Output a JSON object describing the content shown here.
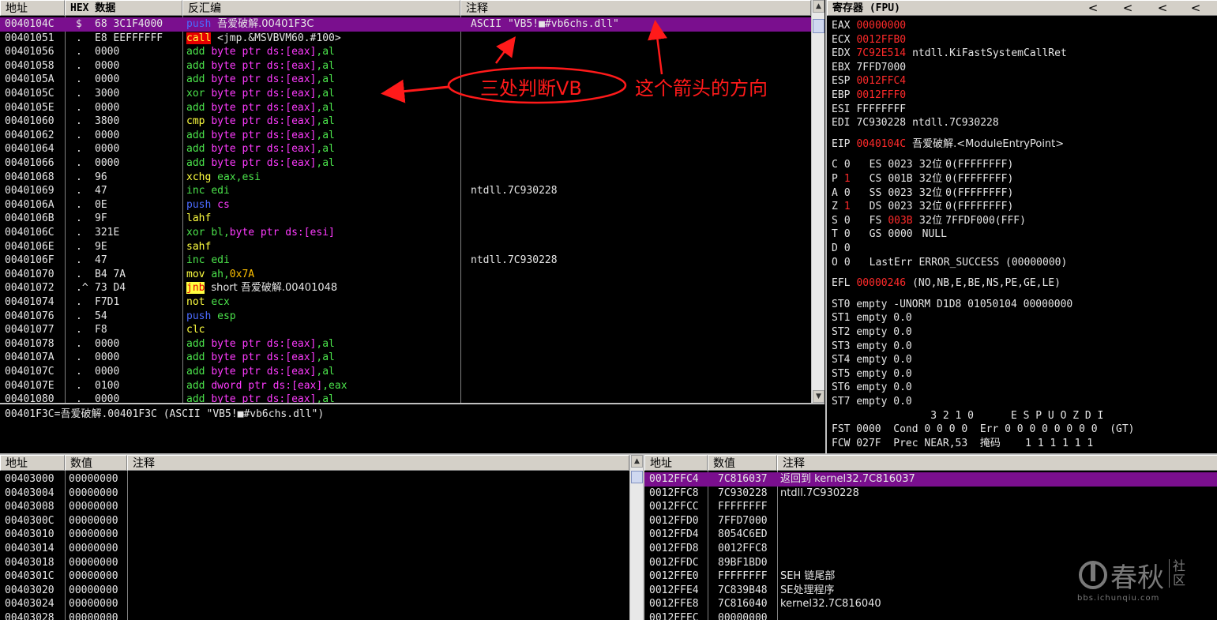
{
  "disasm": {
    "headers": {
      "address": "地址",
      "hex": "HEX 数据",
      "disasm": "反汇编",
      "comment": "注释"
    },
    "rows": [
      {
        "addr": "0040104C",
        "mark": "$",
        "hex": "68 3C1F4000",
        "op": "push",
        "args": [
          {
            "t": "吾爱破解.00401F3C",
            "c": "w"
          }
        ],
        "comment": "ASCII \"VB5!■#vb6chs.dll\"",
        "sel": true,
        "opc": "blue"
      },
      {
        "addr": "00401051",
        "mark": ".",
        "hex": "E8 EEFFFFFF",
        "op": "call",
        "args": [
          {
            "t": "<jmp.&MSVBVM60.#100>",
            "c": "w"
          }
        ],
        "comment": "",
        "opc": "hlred"
      },
      {
        "addr": "00401056",
        "mark": ".",
        "hex": "0000",
        "op": "add",
        "args": [
          {
            "t": "byte ptr ",
            "c": "mag"
          },
          {
            "t": "ds:[eax]",
            "c": "mag"
          },
          {
            "t": ",al",
            "c": "grn"
          }
        ],
        "comment": "",
        "opc": "grn"
      },
      {
        "addr": "00401058",
        "mark": ".",
        "hex": "0000",
        "op": "add",
        "args": [
          {
            "t": "byte ptr ",
            "c": "mag"
          },
          {
            "t": "ds:[eax]",
            "c": "mag"
          },
          {
            "t": ",al",
            "c": "grn"
          }
        ],
        "comment": "",
        "opc": "grn"
      },
      {
        "addr": "0040105A",
        "mark": ".",
        "hex": "0000",
        "op": "add",
        "args": [
          {
            "t": "byte ptr ",
            "c": "mag"
          },
          {
            "t": "ds:[eax]",
            "c": "mag"
          },
          {
            "t": ",al",
            "c": "grn"
          }
        ],
        "comment": "",
        "opc": "grn"
      },
      {
        "addr": "0040105C",
        "mark": ".",
        "hex": "3000",
        "op": "xor",
        "args": [
          {
            "t": "byte ptr ",
            "c": "mag"
          },
          {
            "t": "ds:[eax]",
            "c": "mag"
          },
          {
            "t": ",al",
            "c": "grn"
          }
        ],
        "comment": "",
        "opc": "grn"
      },
      {
        "addr": "0040105E",
        "mark": ".",
        "hex": "0000",
        "op": "add",
        "args": [
          {
            "t": "byte ptr ",
            "c": "mag"
          },
          {
            "t": "ds:[eax]",
            "c": "mag"
          },
          {
            "t": ",al",
            "c": "grn"
          }
        ],
        "comment": "",
        "opc": "grn"
      },
      {
        "addr": "00401060",
        "mark": ".",
        "hex": "3800",
        "op": "cmp",
        "args": [
          {
            "t": "byte ptr ",
            "c": "mag"
          },
          {
            "t": "ds:[eax]",
            "c": "mag"
          },
          {
            "t": ",al",
            "c": "grn"
          }
        ],
        "comment": "",
        "opc": "yel"
      },
      {
        "addr": "00401062",
        "mark": ".",
        "hex": "0000",
        "op": "add",
        "args": [
          {
            "t": "byte ptr ",
            "c": "mag"
          },
          {
            "t": "ds:[eax]",
            "c": "mag"
          },
          {
            "t": ",al",
            "c": "grn"
          }
        ],
        "comment": "",
        "opc": "grn"
      },
      {
        "addr": "00401064",
        "mark": ".",
        "hex": "0000",
        "op": "add",
        "args": [
          {
            "t": "byte ptr ",
            "c": "mag"
          },
          {
            "t": "ds:[eax]",
            "c": "mag"
          },
          {
            "t": ",al",
            "c": "grn"
          }
        ],
        "comment": "",
        "opc": "grn"
      },
      {
        "addr": "00401066",
        "mark": ".",
        "hex": "0000",
        "op": "add",
        "args": [
          {
            "t": "byte ptr ",
            "c": "mag"
          },
          {
            "t": "ds:[eax]",
            "c": "mag"
          },
          {
            "t": ",al",
            "c": "grn"
          }
        ],
        "comment": "",
        "opc": "grn"
      },
      {
        "addr": "00401068",
        "mark": ".",
        "hex": "96",
        "op": "xchg",
        "args": [
          {
            "t": "eax,esi",
            "c": "grn"
          }
        ],
        "comment": "",
        "opc": "yel"
      },
      {
        "addr": "00401069",
        "mark": ".",
        "hex": "47",
        "op": "inc",
        "args": [
          {
            "t": "edi",
            "c": "grn"
          }
        ],
        "comment": "ntdll.7C930228",
        "opc": "grn"
      },
      {
        "addr": "0040106A",
        "mark": ".",
        "hex": "0E",
        "op": "push",
        "args": [
          {
            "t": "cs",
            "c": "mag"
          }
        ],
        "comment": "",
        "opc": "blue"
      },
      {
        "addr": "0040106B",
        "mark": ".",
        "hex": "9F",
        "op": "lahf",
        "args": [],
        "comment": "",
        "opc": "yel"
      },
      {
        "addr": "0040106C",
        "mark": ".",
        "hex": "321E",
        "op": "xor",
        "args": [
          {
            "t": "bl,",
            "c": "grn"
          },
          {
            "t": "byte ptr ds:[esi]",
            "c": "mag"
          }
        ],
        "comment": "",
        "opc": "grn"
      },
      {
        "addr": "0040106E",
        "mark": ".",
        "hex": "9E",
        "op": "sahf",
        "args": [],
        "comment": "",
        "opc": "yel"
      },
      {
        "addr": "0040106F",
        "mark": ".",
        "hex": "47",
        "op": "inc",
        "args": [
          {
            "t": "edi",
            "c": "grn"
          }
        ],
        "comment": "ntdll.7C930228",
        "opc": "grn"
      },
      {
        "addr": "00401070",
        "mark": ".",
        "hex": "B4 7A",
        "op": "mov",
        "args": [
          {
            "t": "ah,",
            "c": "grn"
          },
          {
            "t": "0x7A",
            "c": "org"
          }
        ],
        "comment": "",
        "opc": "yel"
      },
      {
        "addr": "00401072",
        "mark": ".^",
        "hex": "73 D4",
        "op": "jnb",
        "args": [
          {
            "t": "short 吾爱破解.00401048",
            "c": "w"
          }
        ],
        "comment": "",
        "opc": "hlyel"
      },
      {
        "addr": "00401074",
        "mark": ".",
        "hex": "F7D1",
        "op": "not",
        "args": [
          {
            "t": "ecx",
            "c": "grn"
          }
        ],
        "comment": "",
        "opc": "yel"
      },
      {
        "addr": "00401076",
        "mark": ".",
        "hex": "54",
        "op": "push",
        "args": [
          {
            "t": "esp",
            "c": "grn"
          }
        ],
        "comment": "",
        "opc": "blue"
      },
      {
        "addr": "00401077",
        "mark": ".",
        "hex": "F8",
        "op": "clc",
        "args": [],
        "comment": "",
        "opc": "yel"
      },
      {
        "addr": "00401078",
        "mark": ".",
        "hex": "0000",
        "op": "add",
        "args": [
          {
            "t": "byte ptr ",
            "c": "mag"
          },
          {
            "t": "ds:[eax]",
            "c": "mag"
          },
          {
            "t": ",al",
            "c": "grn"
          }
        ],
        "comment": "",
        "opc": "grn"
      },
      {
        "addr": "0040107A",
        "mark": ".",
        "hex": "0000",
        "op": "add",
        "args": [
          {
            "t": "byte ptr ",
            "c": "mag"
          },
          {
            "t": "ds:[eax]",
            "c": "mag"
          },
          {
            "t": ",al",
            "c": "grn"
          }
        ],
        "comment": "",
        "opc": "grn"
      },
      {
        "addr": "0040107C",
        "mark": ".",
        "hex": "0000",
        "op": "add",
        "args": [
          {
            "t": "byte ptr ",
            "c": "mag"
          },
          {
            "t": "ds:[eax]",
            "c": "mag"
          },
          {
            "t": ",al",
            "c": "grn"
          }
        ],
        "comment": "",
        "opc": "grn"
      },
      {
        "addr": "0040107E",
        "mark": ".",
        "hex": "0100",
        "op": "add",
        "args": [
          {
            "t": "dword ptr ",
            "c": "mag"
          },
          {
            "t": "ds:[eax]",
            "c": "mag"
          },
          {
            "t": ",eax",
            "c": "grn"
          }
        ],
        "comment": "",
        "opc": "grn"
      },
      {
        "addr": "00401080",
        "mark": ".",
        "hex": "0000",
        "op": "add",
        "args": [
          {
            "t": "byte ptr ",
            "c": "mag"
          },
          {
            "t": "ds:[eax]",
            "c": "mag"
          },
          {
            "t": ",al",
            "c": "grn"
          }
        ],
        "comment": "",
        "opc": "grn"
      }
    ],
    "info": "00401F3C=吾爱破解.00401F3C (ASCII \"VB5!■#vb6chs.dll\")"
  },
  "annotations": {
    "label1": "三处判断VB",
    "label2": "这个箭头的方向"
  },
  "registers": {
    "title": "寄存器 (FPU)",
    "nav": [
      "<",
      "<",
      "<",
      "<"
    ],
    "gp": [
      {
        "name": "EAX",
        "val": "00000000",
        "red": true,
        "note": ""
      },
      {
        "name": "ECX",
        "val": "0012FFB0",
        "red": true,
        "note": ""
      },
      {
        "name": "EDX",
        "val": "7C92E514",
        "red": true,
        "note": "ntdll.KiFastSystemCallRet"
      },
      {
        "name": "EBX",
        "val": "7FFD7000",
        "red": false,
        "note": ""
      },
      {
        "name": "ESP",
        "val": "0012FFC4",
        "red": true,
        "note": ""
      },
      {
        "name": "EBP",
        "val": "0012FFF0",
        "red": true,
        "note": ""
      },
      {
        "name": "ESI",
        "val": "FFFFFFFF",
        "red": false,
        "note": ""
      },
      {
        "name": "EDI",
        "val": "7C930228",
        "red": false,
        "note": "ntdll.7C930228"
      }
    ],
    "eip": {
      "name": "EIP",
      "val": "0040104C",
      "note": "吾爱破解.<ModuleEntryPoint>"
    },
    "flags": [
      {
        "f": "C",
        "v": "0",
        "red": false,
        "seg": "ES",
        "sv": "0023",
        "sred": false,
        "bits": "32位",
        "rest": "0(FFFFFFFF)"
      },
      {
        "f": "P",
        "v": "1",
        "red": true,
        "seg": "CS",
        "sv": "001B",
        "sred": false,
        "bits": "32位",
        "rest": "0(FFFFFFFF)"
      },
      {
        "f": "A",
        "v": "0",
        "red": false,
        "seg": "SS",
        "sv": "0023",
        "sred": false,
        "bits": "32位",
        "rest": "0(FFFFFFFF)"
      },
      {
        "f": "Z",
        "v": "1",
        "red": true,
        "seg": "DS",
        "sv": "0023",
        "sred": false,
        "bits": "32位",
        "rest": "0(FFFFFFFF)"
      },
      {
        "f": "S",
        "v": "0",
        "red": false,
        "seg": "FS",
        "sv": "003B",
        "sred": true,
        "bits": "32位",
        "rest": "7FFDF000(FFF)"
      },
      {
        "f": "T",
        "v": "0",
        "red": false,
        "seg": "GS",
        "sv": "0000",
        "sred": false,
        "bits": "",
        "rest": "NULL"
      },
      {
        "f": "D",
        "v": "0",
        "red": false,
        "seg": "",
        "sv": "",
        "sred": false,
        "bits": "",
        "rest": ""
      },
      {
        "f": "O",
        "v": "0",
        "red": false,
        "seg": "LastErr",
        "sv": "ERROR_SUCCESS (00000000)",
        "sred": false,
        "bits": "",
        "rest": ""
      }
    ],
    "efl": {
      "name": "EFL",
      "val": "00000246",
      "note": "(NO,NB,E,BE,NS,PE,GE,LE)"
    },
    "st": [
      "ST0 empty -UNORM D1D8 01050104 00000000",
      "ST1 empty 0.0",
      "ST2 empty 0.0",
      "ST3 empty 0.0",
      "ST4 empty 0.0",
      "ST5 empty 0.0",
      "ST6 empty 0.0",
      "ST7 empty 0.0"
    ],
    "fpu_hdr": "                3 2 1 0      E S P U O Z D I",
    "fst": "FST 0000  Cond 0 0 0 0  Err 0 0 0 0 0 0 0 0  (GT)",
    "fcw_a": "FCW 027F  Prec NEAR,53  ",
    "fcw_b": "掩码",
    "fcw_c": "    1 1 1 1 1 1"
  },
  "dump": {
    "headers": {
      "address": "地址",
      "value": "数值",
      "comment": "注释"
    },
    "rows": [
      {
        "addr": "00403000",
        "val": "00000000"
      },
      {
        "addr": "00403004",
        "val": "00000000"
      },
      {
        "addr": "00403008",
        "val": "00000000"
      },
      {
        "addr": "0040300C",
        "val": "00000000"
      },
      {
        "addr": "00403010",
        "val": "00000000"
      },
      {
        "addr": "00403014",
        "val": "00000000"
      },
      {
        "addr": "00403018",
        "val": "00000000"
      },
      {
        "addr": "0040301C",
        "val": "00000000"
      },
      {
        "addr": "00403020",
        "val": "00000000"
      },
      {
        "addr": "00403024",
        "val": "00000000"
      },
      {
        "addr": "00403028",
        "val": "00000000"
      }
    ]
  },
  "stack": {
    "headers": {
      "address": "地址",
      "value": "数值",
      "comment": "注释"
    },
    "rows": [
      {
        "addr": "0012FFC4",
        "val": "7C816037",
        "comment": "返回到 kernel32.7C816037",
        "sel": true
      },
      {
        "addr": "0012FFC8",
        "val": "7C930228",
        "comment": "ntdll.7C930228"
      },
      {
        "addr": "0012FFCC",
        "val": "FFFFFFFF",
        "comment": ""
      },
      {
        "addr": "0012FFD0",
        "val": "7FFD7000",
        "comment": ""
      },
      {
        "addr": "0012FFD4",
        "val": "8054C6ED",
        "comment": ""
      },
      {
        "addr": "0012FFD8",
        "val": "0012FFC8",
        "comment": ""
      },
      {
        "addr": "0012FFDC",
        "val": "89BF1BD0",
        "comment": ""
      },
      {
        "addr": "0012FFE0",
        "val": "FFFFFFFF",
        "comment": "SEH 链尾部"
      },
      {
        "addr": "0012FFE4",
        "val": "7C839B48",
        "comment": "SE处理程序"
      },
      {
        "addr": "0012FFE8",
        "val": "7C816040",
        "comment": "kernel32.7C816040"
      },
      {
        "addr": "0012FFEC",
        "val": "00000000",
        "comment": ""
      }
    ]
  },
  "watermark": {
    "name": "春秋",
    "side": "社区",
    "url": "bbs.ichunqiu.com"
  }
}
